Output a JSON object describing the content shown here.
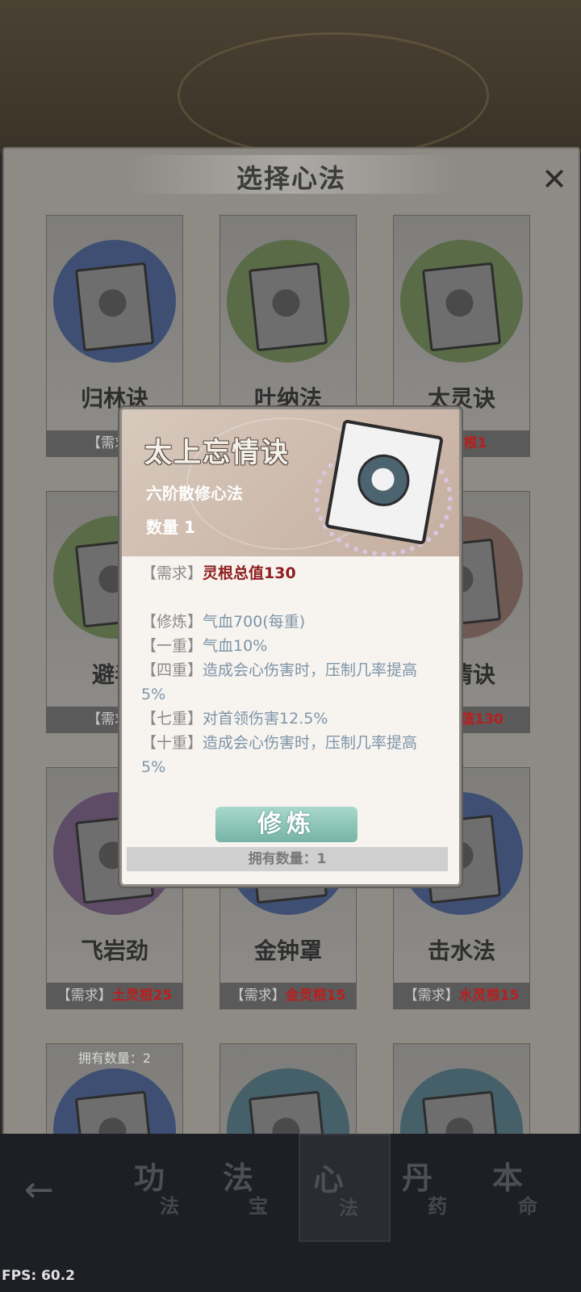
{
  "panel": {
    "title": "选择心法",
    "close_icon": "close-icon"
  },
  "cards": [
    {
      "name": "归林诀",
      "req_label": "【需求】",
      "req_value": "",
      "circle": "#3f4f74",
      "own": ""
    },
    {
      "name": "吐纳法",
      "req_label": "",
      "req_value": "",
      "circle": "#5a6b48",
      "own": ""
    },
    {
      "name": "太灵诀",
      "req_label": "",
      "req_value": "木灵根1",
      "circle": "#5a6b48",
      "own": ""
    },
    {
      "name": "避毒",
      "req_label": "【需求】",
      "req_value": "",
      "circle": "#5a6b48",
      "own": ""
    },
    {
      "name": "",
      "req_label": "",
      "req_value": "",
      "circle": "#5a6b48",
      "own": ""
    },
    {
      "name": "忘情诀",
      "req_label": "",
      "req_value": "灵根总值130",
      "circle": "#6e5a52",
      "own": ""
    },
    {
      "name": "飞岩劲",
      "req_label": "【需求】",
      "req_value": "土灵根25",
      "circle": "#5e4c66",
      "own": ""
    },
    {
      "name": "金钟罩",
      "req_label": "【需求】",
      "req_value": "金灵根15",
      "circle": "#3f4f74",
      "own": ""
    },
    {
      "name": "击水法",
      "req_label": "【需求】",
      "req_value": "水灵根15",
      "circle": "#3f4f74",
      "own": ""
    },
    {
      "name": "",
      "req_label": "",
      "req_value": "",
      "circle": "#3f4f74",
      "own": "拥有数量：2"
    },
    {
      "name": "",
      "req_label": "",
      "req_value": "",
      "circle": "#46606a",
      "own": ""
    },
    {
      "name": "",
      "req_label": "",
      "req_value": "",
      "circle": "#46606a",
      "own": ""
    }
  ],
  "popup": {
    "title": "太上忘情诀",
    "subtitle": "六阶散修心法",
    "count": "数量 1",
    "req_tag": "【需求】",
    "req_value": "灵根总值130",
    "lines": [
      {
        "tag": "【修炼】",
        "text": "气血700(每重)"
      },
      {
        "tag": "【一重】",
        "text": "气血10%"
      },
      {
        "tag": "【四重】",
        "text": "造成会心伤害时，压制几率提高"
      },
      {
        "tag": "",
        "text": "5%"
      },
      {
        "tag": "【七重】",
        "text": "对首领伤害12.5%"
      },
      {
        "tag": "【十重】",
        "text": "造成会心伤害时，压制几率提高"
      },
      {
        "tag": "",
        "text": "5%"
      }
    ],
    "button": "修炼",
    "footer": "拥有数量：1"
  },
  "bottom_nav": {
    "back_icon": "back-arrow-icon",
    "items": [
      {
        "big": "功",
        "small": "法"
      },
      {
        "big": "法",
        "small": "宝"
      },
      {
        "big": "心",
        "small": "法"
      },
      {
        "big": "丹",
        "small": "药"
      },
      {
        "big": "本",
        "small": "命"
      }
    ]
  },
  "fps": "FPS: 60.2"
}
